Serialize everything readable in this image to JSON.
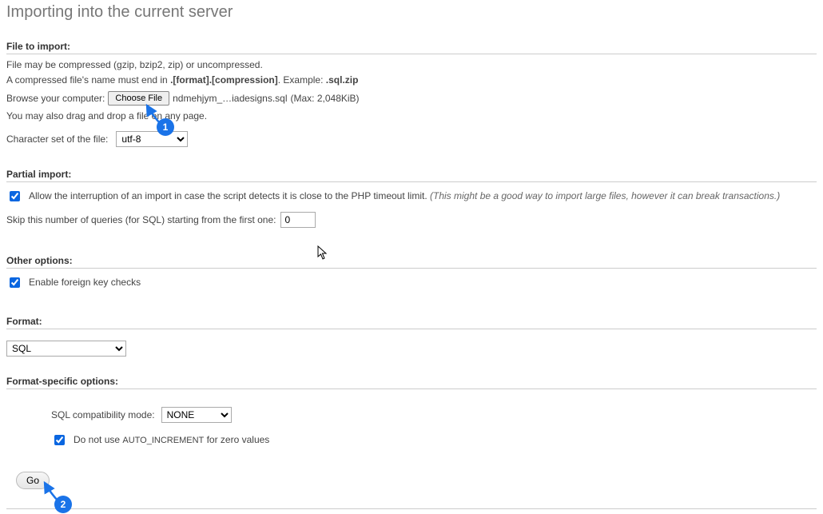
{
  "page": {
    "title": "Importing into the current server"
  },
  "file_import": {
    "label": "File to import:",
    "helper1": "File may be compressed (gzip, bzip2, zip) or uncompressed.",
    "helper2_prefix": "A compressed file's name must end in ",
    "helper2_bold": ".[format].[compression]",
    "helper2_example_label": ". Example: ",
    "helper2_example_bold": ".sql.zip",
    "browse_label": "Browse your computer:",
    "choose_file_btn": "Choose File",
    "filename": "ndmehjym_…iadesigns.sql",
    "maxkb": "(Max: 2,048KiB)",
    "drag_helper": "You may also drag and drop a file on any page.",
    "charset_label": "Character set of the file:",
    "charset_value": "utf-8"
  },
  "partial": {
    "label": "Partial import:",
    "allow_text": "Allow the interruption of an import in case the script detects it is close to the PHP timeout limit. ",
    "allow_hint": "(This might be a good way to import large files, however it can break transactions.)",
    "skip_label": "Skip this number of queries (for SQL) starting from the first one:",
    "skip_value": "0"
  },
  "other": {
    "label": "Other options:",
    "fk_text": "Enable foreign key checks"
  },
  "format": {
    "label": "Format:",
    "value": "SQL"
  },
  "fso": {
    "label": "Format-specific options:",
    "compat_label": "SQL compatibility mode:",
    "compat_value": "NONE",
    "autoinc_prefix": "Do not use ",
    "autoinc_smallcaps": "AUTO_INCREMENT",
    "autoinc_suffix": " for zero values"
  },
  "submit": {
    "go": "Go"
  },
  "markers": {
    "one": "1",
    "two": "2"
  }
}
